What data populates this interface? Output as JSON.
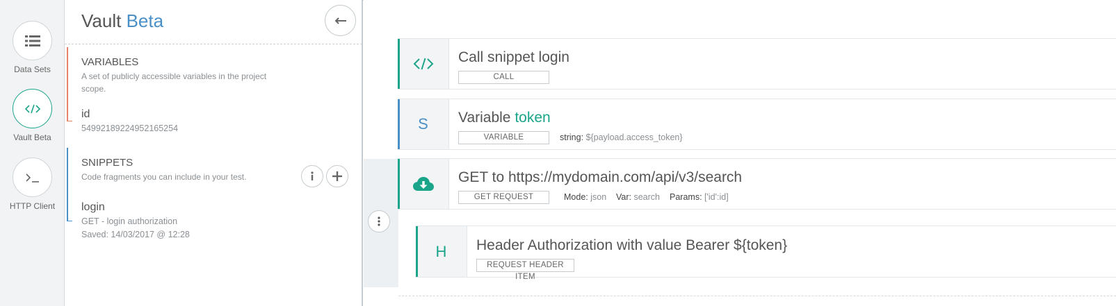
{
  "rail": {
    "items": [
      {
        "label": "Data Sets",
        "icon": "list-icon"
      },
      {
        "label": "Vault Beta",
        "icon": "code-icon"
      },
      {
        "label": "HTTP Client",
        "icon": "terminal-icon"
      }
    ]
  },
  "panel": {
    "title_main": "Vault",
    "title_accent": "Beta",
    "variables": {
      "heading": "VARIABLES",
      "description": "A set of publicly accessible variables in the project scope.",
      "item_name": "id",
      "item_value": "54992189224952165254"
    },
    "snippets": {
      "heading": "SNIPPETS",
      "description": "Code fragments you can include in your test.",
      "item_name": "login",
      "item_desc": "GET - login authorization",
      "item_saved": "Saved: 14/03/2017 @ 12:28"
    }
  },
  "steps": {
    "call": {
      "icon_text": "</>",
      "title": "Call snippet login",
      "tag": "CALL"
    },
    "variable": {
      "icon_text": "S",
      "title_prefix": "Variable",
      "title_name": "token",
      "tag": "VARIABLE",
      "meta_label": "string:",
      "meta_value": "${payload.access_token}"
    },
    "get": {
      "title": "GET to https://mydomain.com/api/v3/search",
      "tag": "GET REQUEST",
      "mode_label": "Mode:",
      "mode_value": "json",
      "var_label": "Var:",
      "var_value": "search",
      "params_label": "Params:",
      "params_value": "['id':id]"
    },
    "header": {
      "icon_text": "H",
      "title": "Header Authorization with value Bearer ${token}",
      "tag": "REQUEST HEADER ITEM"
    }
  },
  "colors": {
    "teal": "#1aa58a",
    "blue": "#4a90c8",
    "red": "#e8836a"
  }
}
